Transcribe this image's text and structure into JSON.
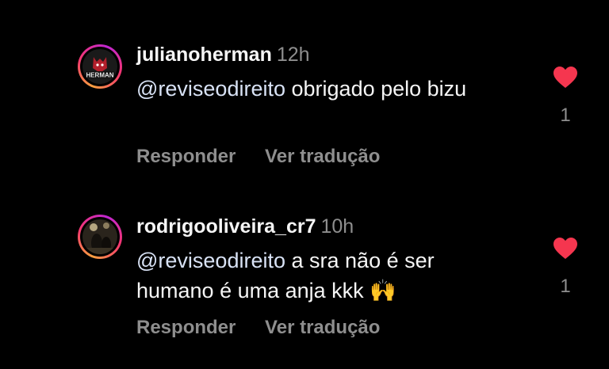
{
  "comments": [
    {
      "username": "julianoherman",
      "time": "12h",
      "mention": "@reviseodireito",
      "text": "obrigado pelo bizu",
      "emoji": "",
      "avatar_label": "HERMAN",
      "reply_label": "Responder",
      "translate_label": "Ver tradução",
      "likes": "1",
      "heart_color": "#f5364f"
    },
    {
      "username": "rodrigooliveira_cr7",
      "time": "10h",
      "mention": "@reviseodireito",
      "text": "a sra não é ser humano é uma anja kkk",
      "emoji": "🙌",
      "avatar_label": "",
      "reply_label": "Responder",
      "translate_label": "Ver tradução",
      "likes": "1",
      "heart_color": "#f5364f"
    }
  ]
}
